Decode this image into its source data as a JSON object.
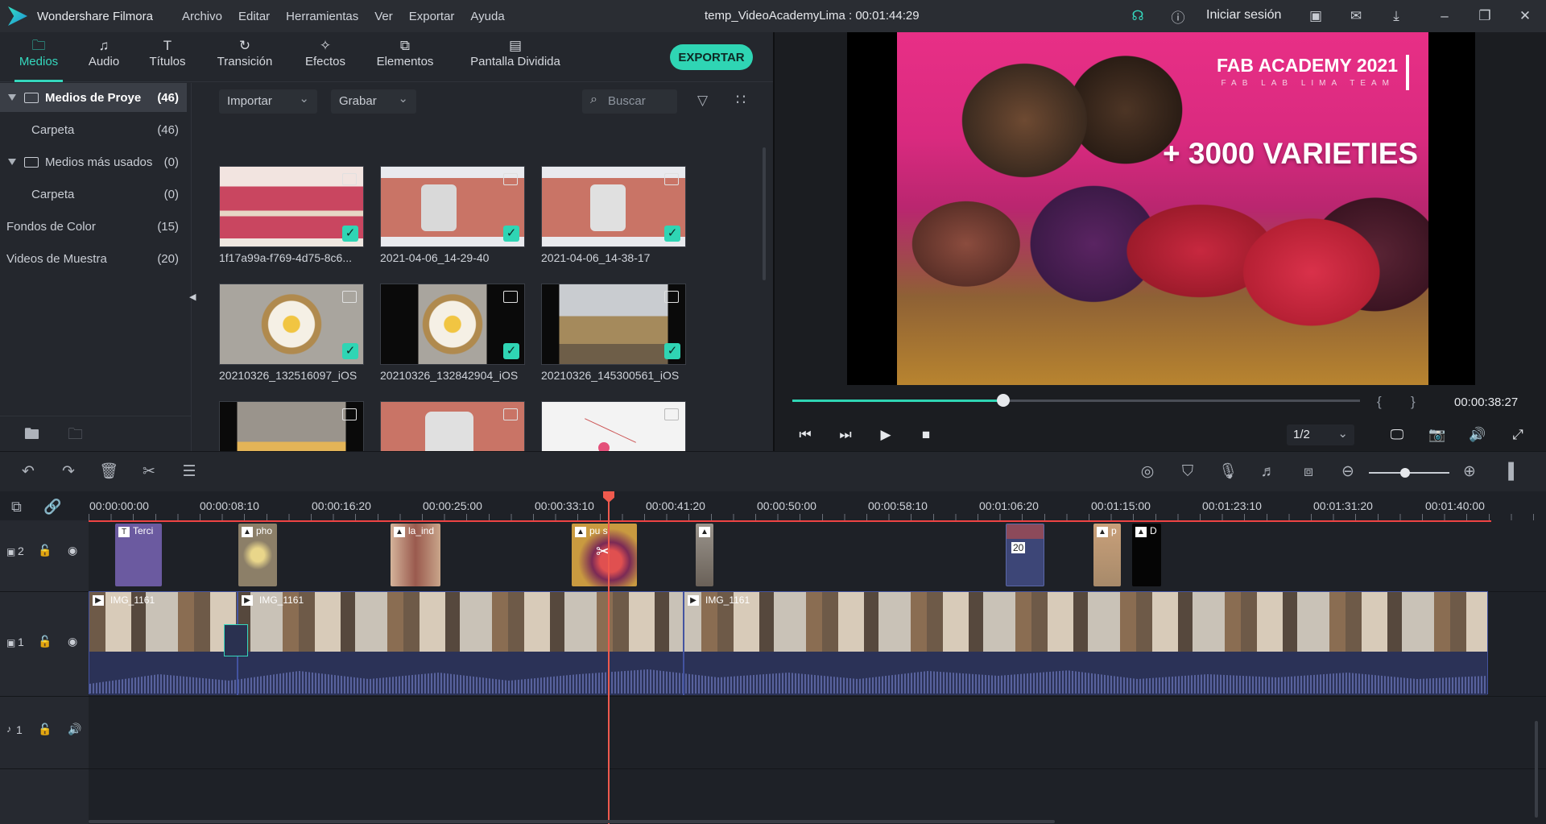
{
  "titlebar": {
    "app_name": "Wondershare Filmora",
    "menu": [
      "Archivo",
      "Editar",
      "Herramientas",
      "Ver",
      "Exportar",
      "Ayuda"
    ],
    "document_title": "temp_VideoAcademyLima : 00:01:44:29",
    "signin": "Iniciar sesión",
    "icons": [
      "headset-icon",
      "info-icon",
      "save-icon",
      "mail-icon",
      "download-icon",
      "minimize-icon",
      "restore-icon",
      "close-icon"
    ]
  },
  "mode_tabs": [
    {
      "label": "Medios",
      "icon": "folder-icon",
      "active": true
    },
    {
      "label": "Audio",
      "icon": "music-icon",
      "active": false
    },
    {
      "label": "Títulos",
      "icon": "text-icon",
      "active": false
    },
    {
      "label": "Transición",
      "icon": "transition-icon",
      "active": false
    },
    {
      "label": "Efectos",
      "icon": "effects-icon",
      "active": false
    },
    {
      "label": "Elementos",
      "icon": "elements-icon",
      "active": false
    },
    {
      "label": "Pantalla Dividida",
      "icon": "split-screen-icon",
      "active": false
    }
  ],
  "export_label": "EXPORTAR",
  "library": [
    {
      "label": "Medios de Proye",
      "count": "(46)",
      "expandable": true,
      "folder": true,
      "selected": true
    },
    {
      "label": "Carpeta",
      "count": "(46)"
    },
    {
      "label": "Medios más usados",
      "count": "(0)",
      "expandable": true,
      "folder": true
    },
    {
      "label": "Carpeta",
      "count": "(0)"
    },
    {
      "label": "Fondos de Color",
      "count": "(15)"
    },
    {
      "label": "Videos de Muestra",
      "count": "(20)"
    }
  ],
  "media_toolbar": {
    "import": "Importar",
    "record": "Grabar",
    "search_placeholder": "Buscar"
  },
  "media_items": [
    {
      "name": "1f17a99a-f769-4d75-8c6...",
      "color": "#c94660",
      "checked": true
    },
    {
      "name": "2021-04-06_14-29-40",
      "color": "#c97466",
      "checked": true
    },
    {
      "name": "2021-04-06_14-38-17",
      "color": "#c97466",
      "checked": true
    },
    {
      "name": "20210326_132516097_iOS",
      "color": "#9f9a92",
      "checked": true
    },
    {
      "name": "20210326_132842904_iOS",
      "color": "#8c8780",
      "checked": true
    },
    {
      "name": "20210326_145300561_iOS",
      "color": "#a58a5c",
      "checked": true
    },
    {
      "name": "",
      "color": "#7a6e60",
      "checked": true
    },
    {
      "name": "",
      "color": "#c97466",
      "checked": false
    },
    {
      "name": "",
      "color": "#f0f0f0",
      "checked": true
    }
  ],
  "preview": {
    "overlay_title": "FAB ACADEMY 2021",
    "overlay_subtitle": "FAB LAB LIMA TEAM",
    "overlay_text": "+ 3000 VARIETIES",
    "time": "00:00:38:27",
    "progress_fraction": 0.372,
    "quality": "1/2",
    "brace_open": "{",
    "brace_close": "}"
  },
  "ruler_labels": [
    "00:00:00:00",
    "00:00:08:10",
    "00:00:16:20",
    "00:00:25:00",
    "00:00:33:10",
    "00:00:41:20",
    "00:00:50:00",
    "00:00:58:10",
    "00:01:06:20",
    "00:01:15:00",
    "00:01:23:10",
    "00:01:31:20",
    "00:01:40:00"
  ],
  "tracks": [
    {
      "label": "2",
      "kind": "video"
    },
    {
      "label": "1",
      "kind": "video"
    },
    {
      "label": "1",
      "kind": "audio"
    }
  ],
  "overlay_clips": [
    {
      "title": "Terci",
      "color": "#6b5aa0"
    },
    {
      "title": "pho",
      "color": "#8c7f68"
    },
    {
      "title": "la_ind",
      "color": "#9a5a4e"
    },
    {
      "title": "pu s",
      "color": "#a0303a"
    },
    {
      "title": "",
      "color": "#6a6158"
    },
    {
      "title": "20",
      "color": "#3d4677"
    },
    {
      "title": "p",
      "color": "#a78a6a"
    },
    {
      "title": "D",
      "color": "#050505"
    }
  ],
  "main_clips": [
    {
      "title": "IMG_1161"
    },
    {
      "title": "IMG_1161"
    },
    {
      "title": "IMG_1161"
    }
  ],
  "zoom_fraction": 0.45
}
